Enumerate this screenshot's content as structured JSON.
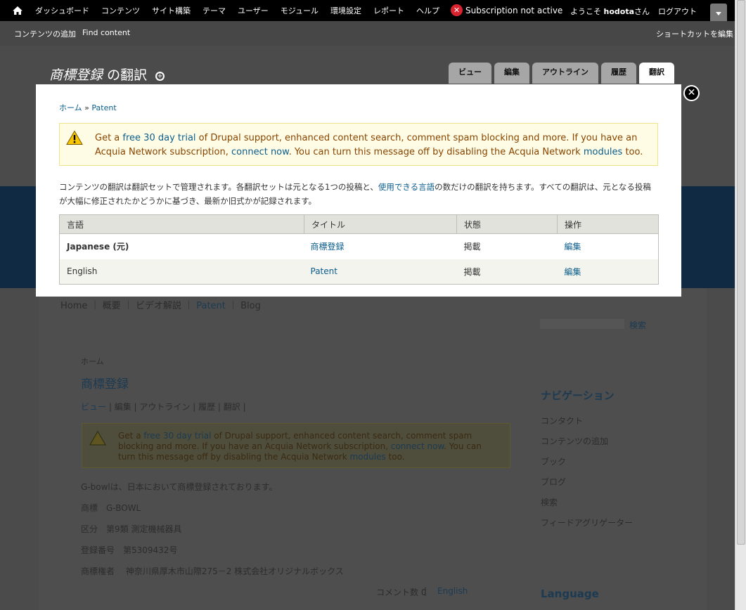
{
  "toolbar": {
    "menu": [
      "ダッシュボード",
      "コンテンツ",
      "サイト構築",
      "テーマ",
      "ユーザー",
      "モジュール",
      "環境設定",
      "レポート",
      "ヘルプ"
    ],
    "subscription_alert": "Subscription not active",
    "welcome_prefix": "ようこそ",
    "username": "hodota",
    "welcome_suffix": "さん",
    "logout": "ログアウト"
  },
  "shortcuts": {
    "add_content": "コンテンツの追加",
    "find_content": "Find content",
    "edit_shortcuts": "ショートカットを編集"
  },
  "header": {
    "title_main": "商標登録",
    "title_suffix": "の翻訳",
    "tabs": [
      "ビュー",
      "編集",
      "アウトライン",
      "履歴",
      "翻訳"
    ],
    "active_tab": "翻訳"
  },
  "overlay": {
    "breadcrumb": [
      "ホーム",
      "Patent"
    ],
    "message": {
      "p1": "Get a ",
      "link1": "free 30 day trial",
      "p2": " of Drupal support, enhanced content search, comment spam blocking and more. If you have an Acquia Network subscription, ",
      "link2": "connect now",
      "p3": ". You can turn this message off by disabling the Acquia Network ",
      "link3": "modules",
      "p4": " too."
    },
    "description": {
      "p1": "コンテンツの翻訳は翻訳セットで管理されます。各翻訳セットは元となる1つの投稿と、",
      "link": "使用できる言語",
      "p2": "の数だけの翻訳を持ちます。すべての翻訳は、元となる投稿が大幅に修正されたかどうかに基づき、最新か旧式かが記録されます。"
    },
    "table": {
      "headers": [
        "言語",
        "タイトル",
        "状態",
        "操作"
      ],
      "rows": [
        {
          "language": "Japanese (元)",
          "title": "商標登録",
          "status": "掲載",
          "action": "編集"
        },
        {
          "language": "English",
          "title": "Patent",
          "status": "掲載",
          "action": "編集"
        }
      ]
    }
  },
  "background_page": {
    "nav": [
      "Home",
      "概要",
      "ビデオ解説",
      "Patent",
      "Blog"
    ],
    "search_button": "検索",
    "breadcrumb": "ホーム",
    "node_title": "商標登録",
    "node_tabs": [
      "ビュー",
      "編集",
      "アウトライン",
      "履歴",
      "翻訳"
    ],
    "message": {
      "p1": "Get a ",
      "link1": "free 30 day trial",
      "p2": " of Drupal support, enhanced content search, comment spam blocking and more. If you have an Acquia Network subscription, ",
      "link2": "connect now",
      "p3": ". You can turn this message off by disabling the Acquia Network ",
      "link3": "modules",
      "p4": " too."
    },
    "body_lines": [
      "G-bowlは、日本において商標登録されております。",
      "商標　G-BOWL",
      "区分　第9類  測定機械器具",
      "登録番号　第5309432号",
      "商標権者　 神奈川県厚木市山際275－2  株式会社オリジナルボックス"
    ],
    "comments": "コメント数 0",
    "language_link": "English",
    "sidebar_nav_title": "ナビゲーション",
    "sidebar_nav": [
      "コンタクト",
      "コンテンツの追加",
      "ブック",
      "ブログ",
      "検索",
      "フィードアグリゲーター"
    ],
    "sidebar_lang_title": "Language"
  }
}
